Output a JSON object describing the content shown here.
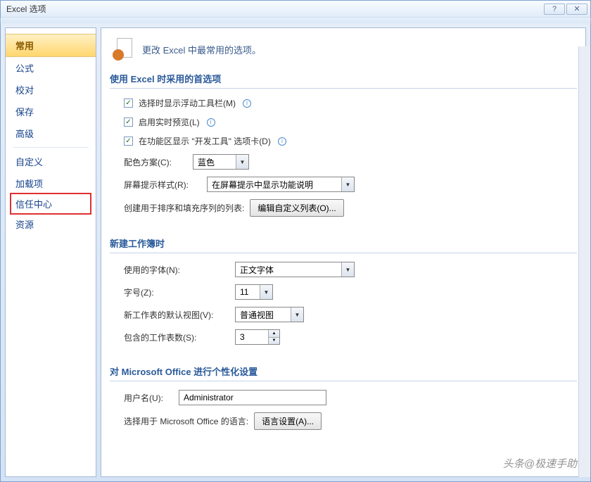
{
  "titlebar": {
    "title": "Excel 选项",
    "help": "?",
    "close": "✕"
  },
  "sidebar": {
    "items": [
      {
        "label": "常用",
        "active": true
      },
      {
        "label": "公式"
      },
      {
        "label": "校对"
      },
      {
        "label": "保存"
      },
      {
        "label": "高级"
      },
      {
        "label": "自定义",
        "divider_before": true
      },
      {
        "label": "加载项"
      },
      {
        "label": "信任中心",
        "highlight": true
      },
      {
        "label": "资源"
      }
    ]
  },
  "header": {
    "text": "更改 Excel 中最常用的选项。"
  },
  "section1": {
    "title": "使用 Excel 时采用的首选项",
    "cb1": "选择时显示浮动工具栏(M)",
    "cb2": "启用实时预览(L)",
    "cb3": "在功能区显示 \"开发工具\" 选项卡(D)",
    "color_label": "配色方案(C):",
    "color_value": "蓝色",
    "tooltip_label": "屏幕提示样式(R):",
    "tooltip_value": "在屏幕提示中显示功能说明",
    "list_label": "创建用于排序和填充序列的列表:",
    "list_button": "编辑自定义列表(O)..."
  },
  "section2": {
    "title": "新建工作簿时",
    "font_label": "使用的字体(N):",
    "font_value": "正文字体",
    "size_label": "字号(Z):",
    "size_value": "11",
    "view_label": "新工作表的默认视图(V):",
    "view_value": "普通视图",
    "sheets_label": "包含的工作表数(S):",
    "sheets_value": "3"
  },
  "section3": {
    "title": "对 Microsoft Office 进行个性化设置",
    "user_label": "用户名(U):",
    "user_value": "Administrator",
    "lang_label": "选择用于 Microsoft Office 的语言:",
    "lang_button": "语言设置(A)..."
  },
  "watermark": "头条@极速手助"
}
